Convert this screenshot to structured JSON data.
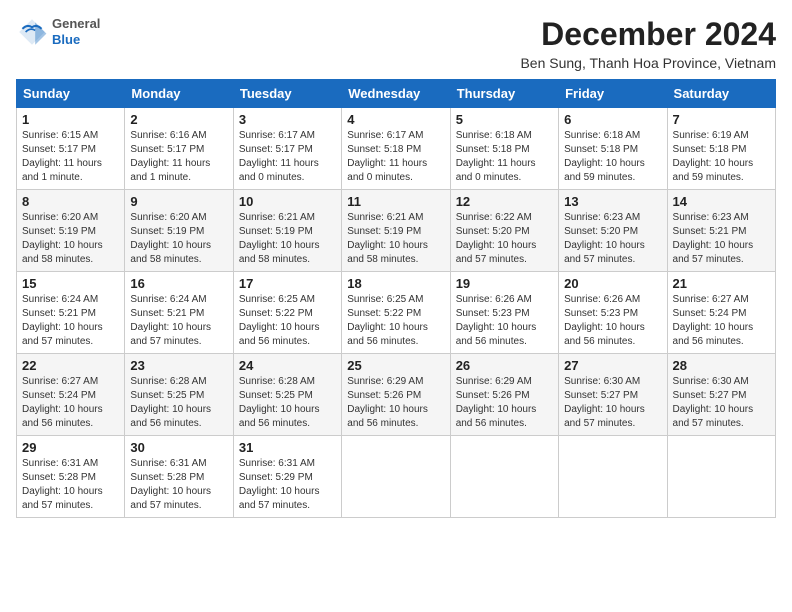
{
  "header": {
    "logo": {
      "general": "General",
      "blue": "Blue"
    },
    "title": "December 2024",
    "location": "Ben Sung, Thanh Hoa Province, Vietnam"
  },
  "columns": [
    "Sunday",
    "Monday",
    "Tuesday",
    "Wednesday",
    "Thursday",
    "Friday",
    "Saturday"
  ],
  "weeks": [
    [
      {
        "day": "1",
        "sunrise": "6:15 AM",
        "sunset": "5:17 PM",
        "daylight": "11 hours and 1 minute."
      },
      {
        "day": "2",
        "sunrise": "6:16 AM",
        "sunset": "5:17 PM",
        "daylight": "11 hours and 1 minute."
      },
      {
        "day": "3",
        "sunrise": "6:17 AM",
        "sunset": "5:17 PM",
        "daylight": "11 hours and 0 minutes."
      },
      {
        "day": "4",
        "sunrise": "6:17 AM",
        "sunset": "5:18 PM",
        "daylight": "11 hours and 0 minutes."
      },
      {
        "day": "5",
        "sunrise": "6:18 AM",
        "sunset": "5:18 PM",
        "daylight": "11 hours and 0 minutes."
      },
      {
        "day": "6",
        "sunrise": "6:18 AM",
        "sunset": "5:18 PM",
        "daylight": "10 hours and 59 minutes."
      },
      {
        "day": "7",
        "sunrise": "6:19 AM",
        "sunset": "5:18 PM",
        "daylight": "10 hours and 59 minutes."
      }
    ],
    [
      {
        "day": "8",
        "sunrise": "6:20 AM",
        "sunset": "5:19 PM",
        "daylight": "10 hours and 58 minutes."
      },
      {
        "day": "9",
        "sunrise": "6:20 AM",
        "sunset": "5:19 PM",
        "daylight": "10 hours and 58 minutes."
      },
      {
        "day": "10",
        "sunrise": "6:21 AM",
        "sunset": "5:19 PM",
        "daylight": "10 hours and 58 minutes."
      },
      {
        "day": "11",
        "sunrise": "6:21 AM",
        "sunset": "5:19 PM",
        "daylight": "10 hours and 58 minutes."
      },
      {
        "day": "12",
        "sunrise": "6:22 AM",
        "sunset": "5:20 PM",
        "daylight": "10 hours and 57 minutes."
      },
      {
        "day": "13",
        "sunrise": "6:23 AM",
        "sunset": "5:20 PM",
        "daylight": "10 hours and 57 minutes."
      },
      {
        "day": "14",
        "sunrise": "6:23 AM",
        "sunset": "5:21 PM",
        "daylight": "10 hours and 57 minutes."
      }
    ],
    [
      {
        "day": "15",
        "sunrise": "6:24 AM",
        "sunset": "5:21 PM",
        "daylight": "10 hours and 57 minutes."
      },
      {
        "day": "16",
        "sunrise": "6:24 AM",
        "sunset": "5:21 PM",
        "daylight": "10 hours and 57 minutes."
      },
      {
        "day": "17",
        "sunrise": "6:25 AM",
        "sunset": "5:22 PM",
        "daylight": "10 hours and 56 minutes."
      },
      {
        "day": "18",
        "sunrise": "6:25 AM",
        "sunset": "5:22 PM",
        "daylight": "10 hours and 56 minutes."
      },
      {
        "day": "19",
        "sunrise": "6:26 AM",
        "sunset": "5:23 PM",
        "daylight": "10 hours and 56 minutes."
      },
      {
        "day": "20",
        "sunrise": "6:26 AM",
        "sunset": "5:23 PM",
        "daylight": "10 hours and 56 minutes."
      },
      {
        "day": "21",
        "sunrise": "6:27 AM",
        "sunset": "5:24 PM",
        "daylight": "10 hours and 56 minutes."
      }
    ],
    [
      {
        "day": "22",
        "sunrise": "6:27 AM",
        "sunset": "5:24 PM",
        "daylight": "10 hours and 56 minutes."
      },
      {
        "day": "23",
        "sunrise": "6:28 AM",
        "sunset": "5:25 PM",
        "daylight": "10 hours and 56 minutes."
      },
      {
        "day": "24",
        "sunrise": "6:28 AM",
        "sunset": "5:25 PM",
        "daylight": "10 hours and 56 minutes."
      },
      {
        "day": "25",
        "sunrise": "6:29 AM",
        "sunset": "5:26 PM",
        "daylight": "10 hours and 56 minutes."
      },
      {
        "day": "26",
        "sunrise": "6:29 AM",
        "sunset": "5:26 PM",
        "daylight": "10 hours and 56 minutes."
      },
      {
        "day": "27",
        "sunrise": "6:30 AM",
        "sunset": "5:27 PM",
        "daylight": "10 hours and 57 minutes."
      },
      {
        "day": "28",
        "sunrise": "6:30 AM",
        "sunset": "5:27 PM",
        "daylight": "10 hours and 57 minutes."
      }
    ],
    [
      {
        "day": "29",
        "sunrise": "6:31 AM",
        "sunset": "5:28 PM",
        "daylight": "10 hours and 57 minutes."
      },
      {
        "day": "30",
        "sunrise": "6:31 AM",
        "sunset": "5:28 PM",
        "daylight": "10 hours and 57 minutes."
      },
      {
        "day": "31",
        "sunrise": "6:31 AM",
        "sunset": "5:29 PM",
        "daylight": "10 hours and 57 minutes."
      },
      null,
      null,
      null,
      null
    ]
  ],
  "labels": {
    "sunrise": "Sunrise:",
    "sunset": "Sunset:",
    "daylight": "Daylight:"
  }
}
